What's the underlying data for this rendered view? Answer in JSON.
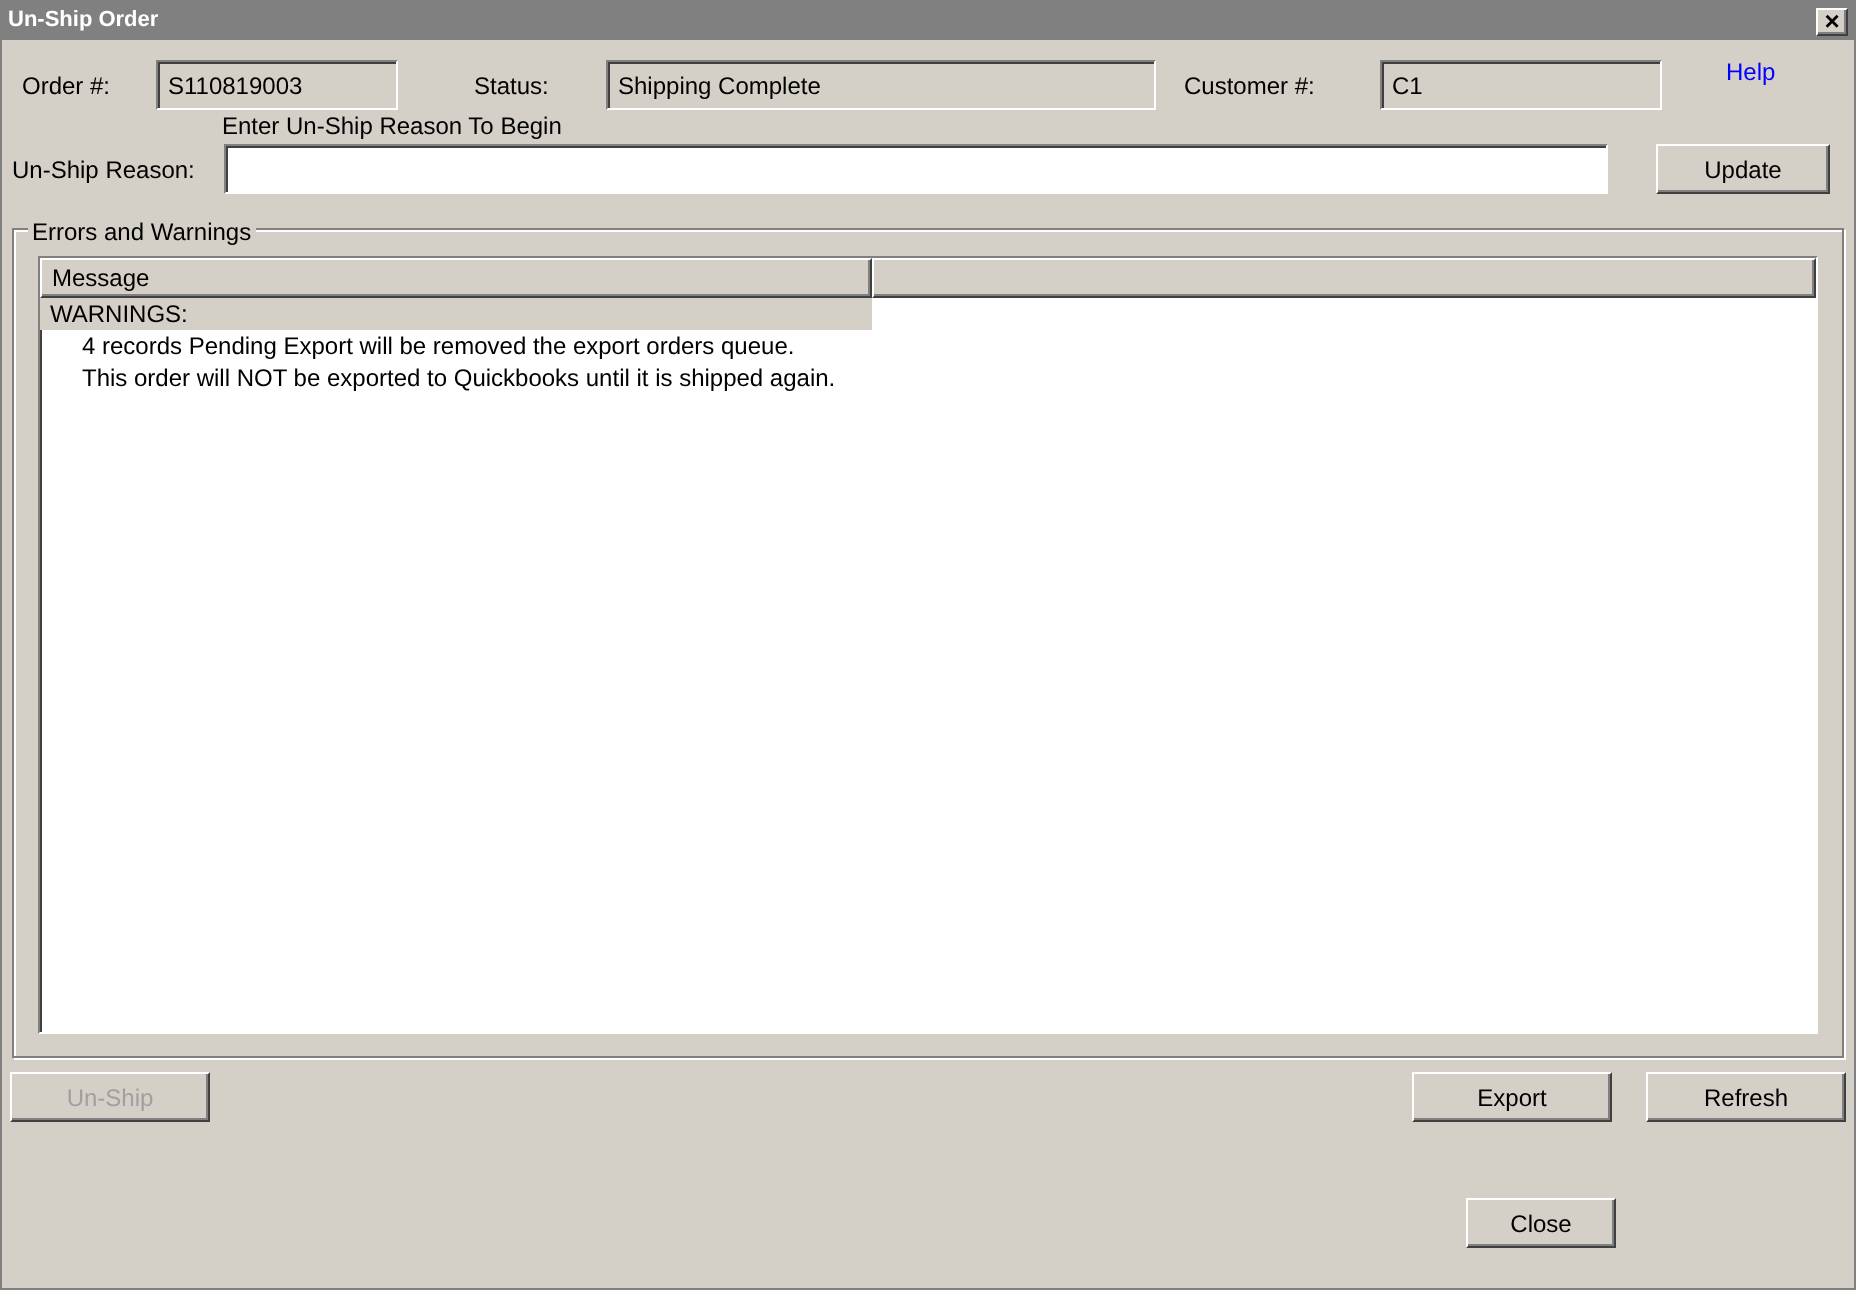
{
  "window": {
    "title": "Un-Ship Order",
    "close": "×"
  },
  "fields": [
    {
      "label": "Order #:",
      "value": "S110819003"
    },
    {
      "label": "Status:",
      "value": "Shipping Complete"
    },
    {
      "label": "Customer #:",
      "value": "C1"
    }
  ],
  "help_link": "Help",
  "reason": {
    "hint": "Enter Un-Ship Reason To Begin",
    "label": "Un-Ship Reason:"
  },
  "update_button": "Update",
  "group": {
    "title": "Errors and Warnings",
    "table": {
      "columns": [
        "Message"
      ],
      "rows": [
        {
          "text": "WARNINGS:",
          "kind": "heading",
          "selected": true
        },
        {
          "text": "4 records Pending Export will be removed the export orders queue.",
          "kind": "item",
          "selected": false
        },
        {
          "text": "This order will NOT be exported to Quickbooks until it is shipped again.",
          "kind": "item",
          "selected": false
        }
      ]
    }
  },
  "buttons": [
    {
      "label": "Un-Ship",
      "disabled": true
    },
    {
      "label": "Export",
      "disabled": false
    },
    {
      "label": "Refresh",
      "disabled": false
    }
  ],
  "close_button": "Close"
}
